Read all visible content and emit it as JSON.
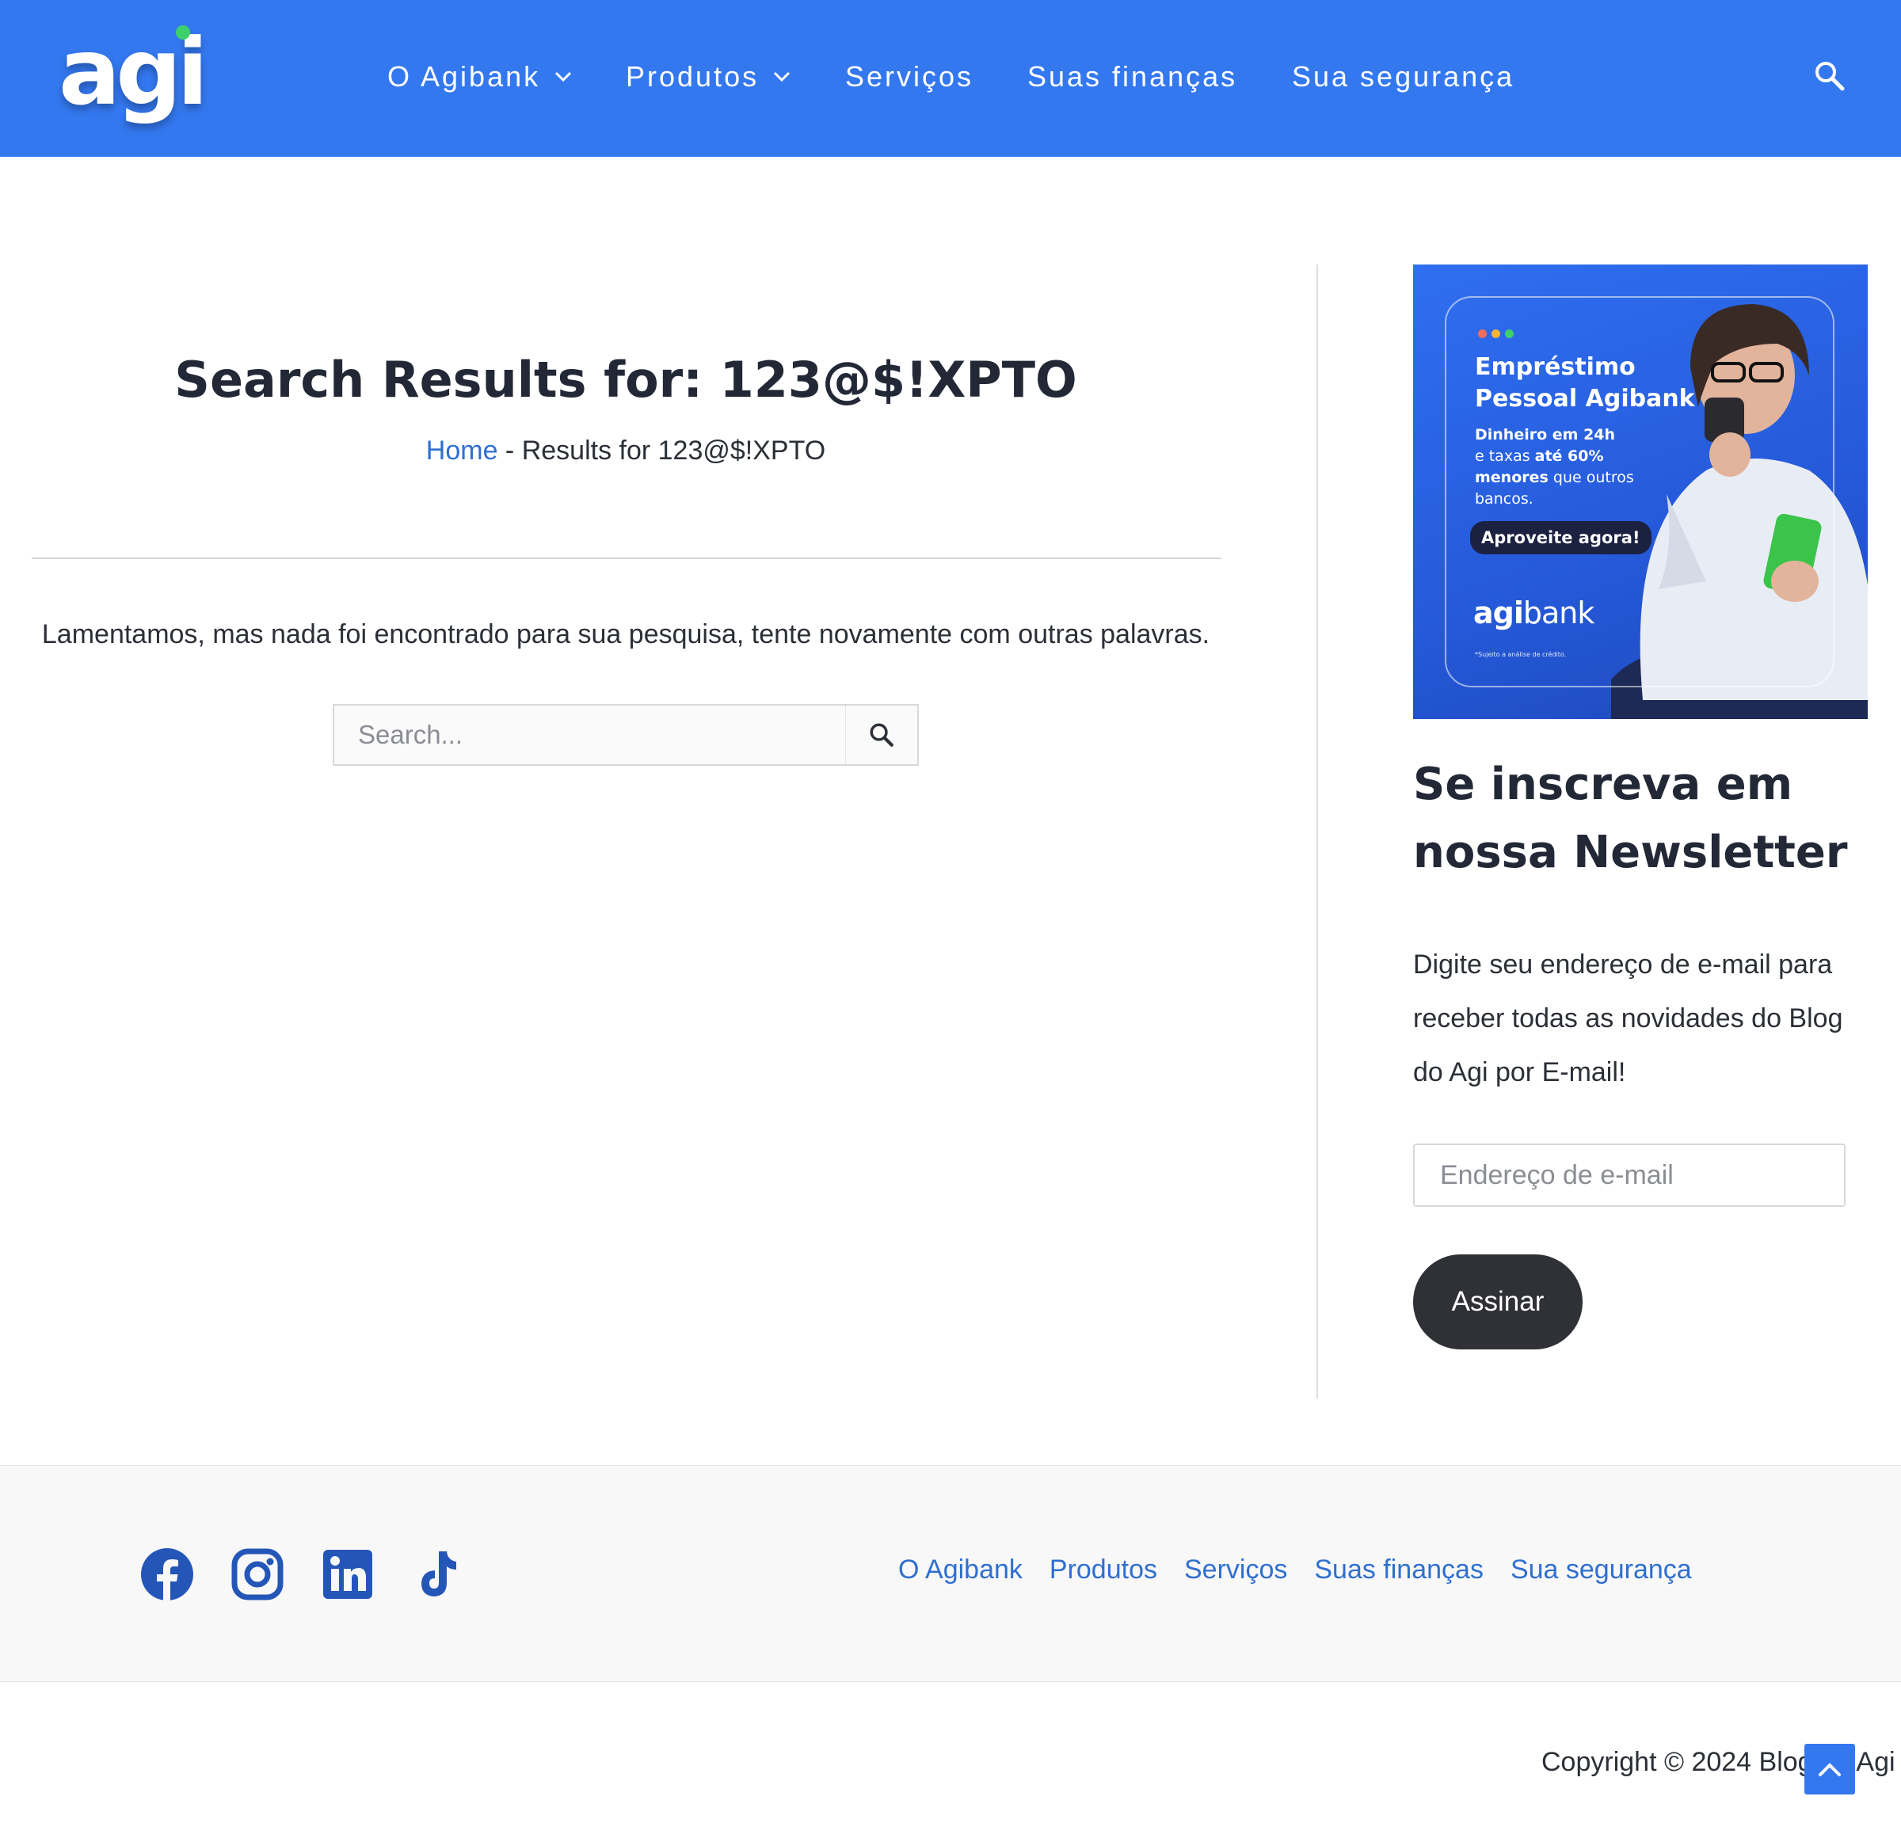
{
  "header": {
    "logo_text": "agi",
    "nav": [
      {
        "label": "O Agibank",
        "has_dropdown": true
      },
      {
        "label": "Produtos",
        "has_dropdown": true
      },
      {
        "label": "Serviços",
        "has_dropdown": false
      },
      {
        "label": "Suas finanças",
        "has_dropdown": false
      },
      {
        "label": "Sua segurança",
        "has_dropdown": false
      }
    ],
    "search_icon": "search-icon"
  },
  "main": {
    "title": "Search Results for: 123@$!XPTO",
    "breadcrumb": {
      "home": "Home",
      "separator": " - ",
      "current": "Results for 123@$!XPTO"
    },
    "no_results": "Lamentamos, mas nada foi encontrado para sua pesquisa, tente novamente com outras palavras.",
    "search": {
      "placeholder": "Search...",
      "value": ""
    }
  },
  "sidebar": {
    "ad": {
      "title_line1": "Empréstimo",
      "title_line2": "Pessoal Agibank",
      "text_line1": "Dinheiro em 24h",
      "text_line2_pre": "e taxas ",
      "text_line2_bold": "até 60%",
      "text_line3_bold": "menores",
      "text_line3_post": " que outros",
      "text_line4": "bancos.",
      "cta": "Aproveite agora!",
      "brand_bold": "agi",
      "brand_rest": "bank",
      "note": "*Sujeito a análise de crédito."
    },
    "newsletter": {
      "title": "Se inscreva em nossa Newsletter",
      "text": "Digite seu endereço de e-mail para receber todas as novidades do Blog do Agi por E-mail!",
      "email_placeholder": "Endereço de e-mail",
      "button": "Assinar"
    }
  },
  "footer": {
    "social": [
      "facebook-icon",
      "instagram-icon",
      "linkedin-icon",
      "tiktok-icon"
    ],
    "nav": [
      "O Agibank",
      "Produtos",
      "Serviços",
      "Suas finanças",
      "Sua segurança"
    ],
    "copyright": "Copyright © 2024 Blog do Agi |"
  },
  "colors": {
    "brand_blue": "#3478f0",
    "link_blue": "#2f6fd0",
    "footer_icon_blue": "#2456b8",
    "dark_button": "#2f3136"
  }
}
